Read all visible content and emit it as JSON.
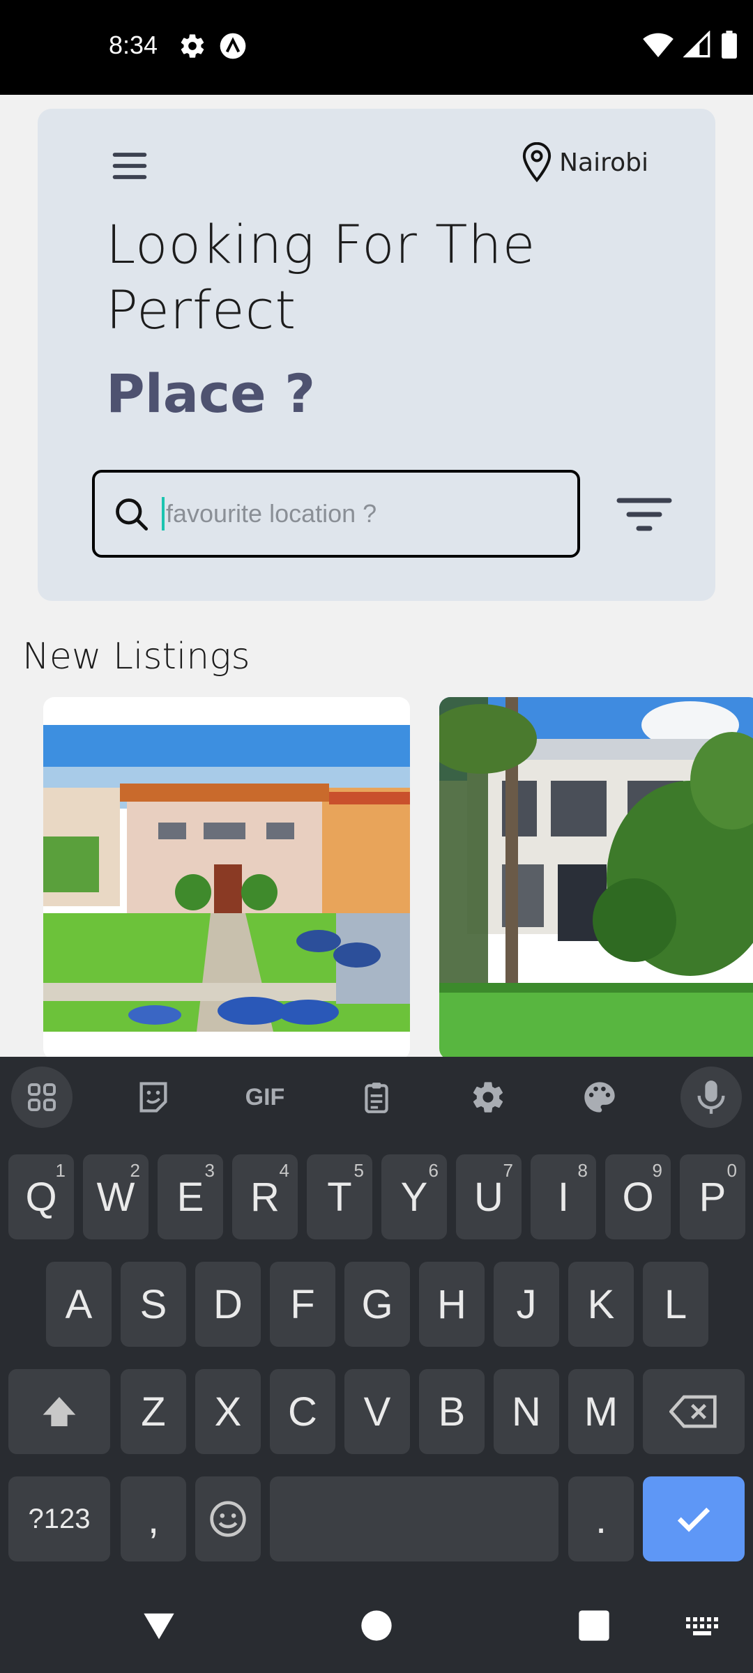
{
  "status_bar": {
    "time": "8:34",
    "icons_left": [
      "gear-icon",
      "a-circle-icon"
    ],
    "icons_right": [
      "wifi-icon",
      "signal-icon",
      "battery-icon"
    ]
  },
  "header": {
    "location": "Nairobi",
    "title": "Looking For The Perfect",
    "title_emphasis": "Place ?",
    "accent_color": "#4e5270"
  },
  "search": {
    "placeholder": "favourite location ?",
    "value": ""
  },
  "sections": {
    "new_listings": "New Listings"
  },
  "listings": [
    {
      "image": "house-photo-1"
    },
    {
      "image": "house-photo-2"
    }
  ],
  "keyboard": {
    "toolbar": [
      "apps-grid-icon",
      "sticker-icon",
      "GIF",
      "clipboard-icon",
      "settings-icon",
      "palette-icon",
      "mic-icon"
    ],
    "row1": [
      {
        "key": "Q",
        "hint": "1"
      },
      {
        "key": "W",
        "hint": "2"
      },
      {
        "key": "E",
        "hint": "3"
      },
      {
        "key": "R",
        "hint": "4"
      },
      {
        "key": "T",
        "hint": "5"
      },
      {
        "key": "Y",
        "hint": "6"
      },
      {
        "key": "U",
        "hint": "7"
      },
      {
        "key": "I",
        "hint": "8"
      },
      {
        "key": "O",
        "hint": "9"
      },
      {
        "key": "P",
        "hint": "0"
      }
    ],
    "row2": [
      "A",
      "S",
      "D",
      "F",
      "G",
      "H",
      "J",
      "K",
      "L"
    ],
    "row3": [
      "Z",
      "X",
      "C",
      "V",
      "B",
      "N",
      "M"
    ],
    "symbols_key": "?123",
    "comma": ",",
    "period": ".",
    "enter_color": "#5e97f6"
  }
}
